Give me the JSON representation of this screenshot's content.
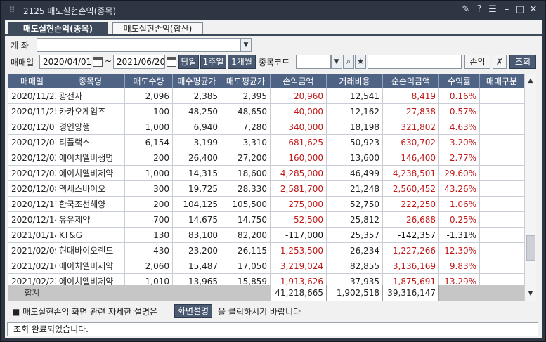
{
  "window": {
    "title": "2125 매도실현손익(종목)",
    "app_icon": "grip-icon"
  },
  "tabs": [
    {
      "label": "매도실현손익(종목)",
      "active": true
    },
    {
      "label": "매도실현손익(합산)",
      "active": false
    }
  ],
  "filters": {
    "account_label": "계 좌",
    "date_label": "매매일",
    "date_from": "2020/04/01",
    "date_sep": "~",
    "date_to": "2021/06/20",
    "period_buttons": [
      "당일",
      "1주일",
      "1개월"
    ],
    "stock_code_label": "종목코드",
    "pnl_button": "손익",
    "search_button": "조회"
  },
  "table": {
    "columns": [
      "매매일",
      "종목명",
      "매도수량",
      "매수평균가",
      "매도평균가",
      "손익금액",
      "거래비용",
      "순손익금액",
      "수익률",
      "매매구분"
    ],
    "rows": [
      {
        "date": "2020/11/23",
        "name": "광전자",
        "qty": "2,096",
        "buy_avg": "2,385",
        "sell_avg": "2,395",
        "pnl": "20,960",
        "cost": "12,541",
        "net": "8,419",
        "rate": "0.16%",
        "type": "",
        "positive": true
      },
      {
        "date": "2020/11/25",
        "name": "카카오게임즈",
        "qty": "100",
        "buy_avg": "48,250",
        "sell_avg": "48,650",
        "pnl": "40,000",
        "cost": "12,162",
        "net": "27,838",
        "rate": "0.57%",
        "type": "",
        "positive": true
      },
      {
        "date": "2020/12/01",
        "name": "경인양행",
        "qty": "1,000",
        "buy_avg": "6,940",
        "sell_avg": "7,280",
        "pnl": "340,000",
        "cost": "18,198",
        "net": "321,802",
        "rate": "4.63%",
        "type": "",
        "positive": true
      },
      {
        "date": "2020/12/01",
        "name": "티플랙스",
        "qty": "6,154",
        "buy_avg": "3,199",
        "sell_avg": "3,310",
        "pnl": "681,625",
        "cost": "50,923",
        "net": "630,702",
        "rate": "3.20%",
        "type": "",
        "positive": true
      },
      {
        "date": "2020/12/02",
        "name": "에이치엘비생명",
        "qty": "200",
        "buy_avg": "26,400",
        "sell_avg": "27,200",
        "pnl": "160,000",
        "cost": "13,600",
        "net": "146,400",
        "rate": "2.77%",
        "type": "",
        "positive": true
      },
      {
        "date": "2020/12/03",
        "name": "에이치엘비제약",
        "qty": "1,000",
        "buy_avg": "14,315",
        "sell_avg": "18,600",
        "pnl": "4,285,000",
        "cost": "46,499",
        "net": "4,238,501",
        "rate": "29.60%",
        "type": "",
        "positive": true
      },
      {
        "date": "2020/12/08",
        "name": "엑세스바이오",
        "qty": "300",
        "buy_avg": "19,725",
        "sell_avg": "28,330",
        "pnl": "2,581,700",
        "cost": "21,248",
        "net": "2,560,452",
        "rate": "43.26%",
        "type": "",
        "positive": true
      },
      {
        "date": "2020/12/11",
        "name": "한국조선해양",
        "qty": "200",
        "buy_avg": "104,125",
        "sell_avg": "105,500",
        "pnl": "275,000",
        "cost": "52,750",
        "net": "222,250",
        "rate": "1.06%",
        "type": "",
        "positive": true
      },
      {
        "date": "2020/12/14",
        "name": "유유제약",
        "qty": "700",
        "buy_avg": "14,675",
        "sell_avg": "14,750",
        "pnl": "52,500",
        "cost": "25,812",
        "net": "26,688",
        "rate": "0.25%",
        "type": "",
        "positive": true
      },
      {
        "date": "2021/01/14",
        "name": "KT&G",
        "qty": "130",
        "buy_avg": "83,100",
        "sell_avg": "82,200",
        "pnl": "-117,000",
        "cost": "25,357",
        "net": "-142,357",
        "rate": "-1.31%",
        "type": "",
        "positive": false
      },
      {
        "date": "2021/02/09",
        "name": "현대바이오랜드",
        "qty": "430",
        "buy_avg": "23,200",
        "sell_avg": "26,115",
        "pnl": "1,253,500",
        "cost": "26,234",
        "net": "1,227,266",
        "rate": "12.30%",
        "type": "",
        "positive": true
      },
      {
        "date": "2021/02/16",
        "name": "에이치엘비제약",
        "qty": "2,060",
        "buy_avg": "15,487",
        "sell_avg": "17,050",
        "pnl": "3,219,024",
        "cost": "82,855",
        "net": "3,136,169",
        "rate": "9.83%",
        "type": "",
        "positive": true
      },
      {
        "date": "2021/02/22",
        "name": "에이치엘비제약",
        "qty": "1,010",
        "buy_avg": "13,965",
        "sell_avg": "15,859",
        "pnl": "1,913,626",
        "cost": "37,935",
        "net": "1,875,691",
        "rate": "13.29%",
        "type": "",
        "positive": true
      }
    ],
    "total": {
      "label": "합계",
      "pnl": "41,218,665",
      "cost": "1,902,518",
      "net": "39,316,147"
    }
  },
  "help": {
    "text_before": "■ 매도실현손익 화면 관련 자세한 설명은",
    "button": "화면설명",
    "text_after": "을 클릭하시기 바랍니다"
  },
  "status": "조회 완료되었습니다.",
  "colors": {
    "positive": "#c01818",
    "header_bg": "#4f6384",
    "title_bg": "#2e3644"
  }
}
